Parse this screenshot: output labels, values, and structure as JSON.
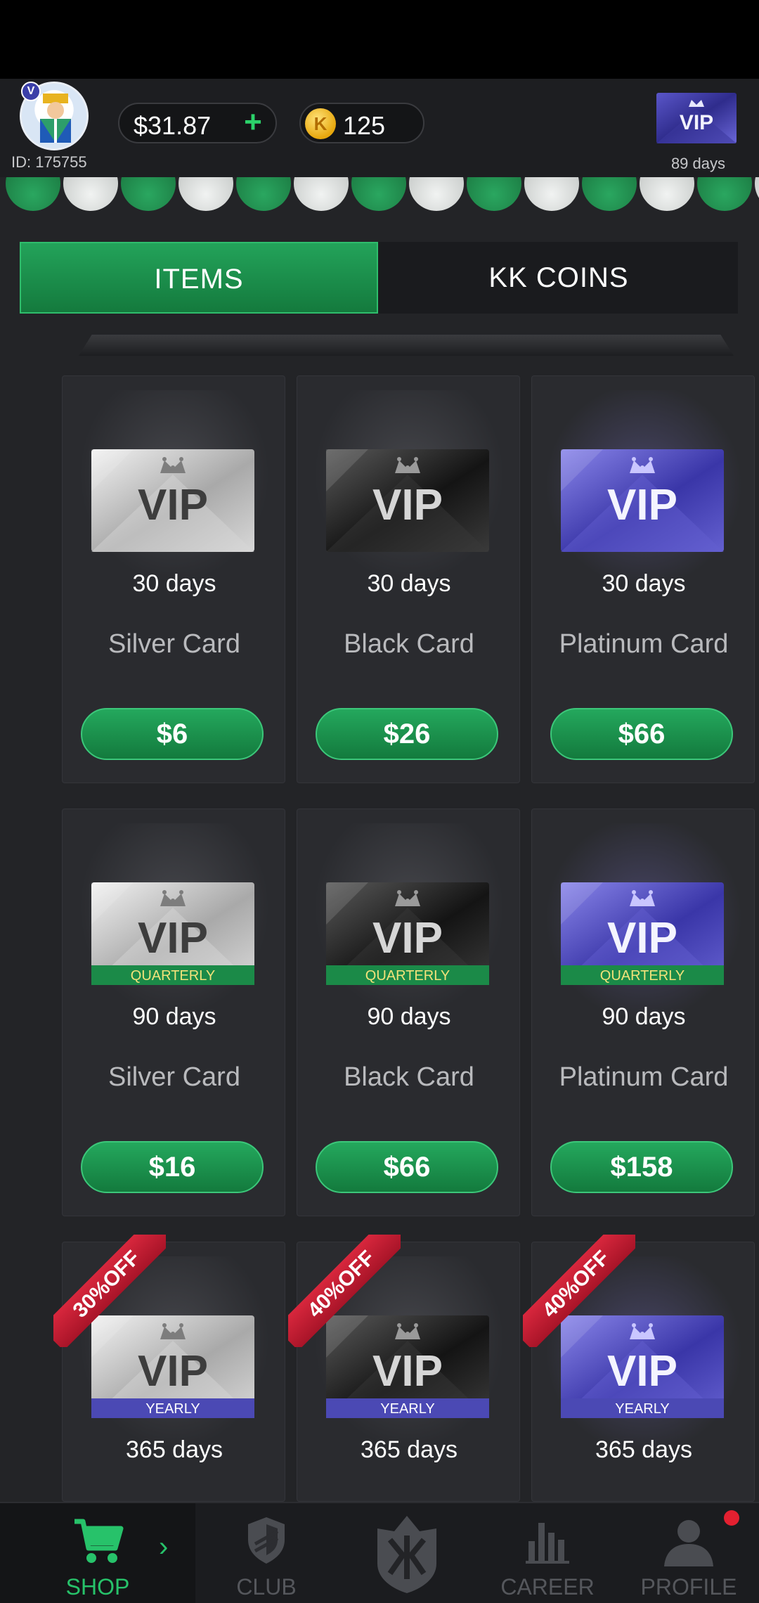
{
  "header": {
    "user_id": "ID: 175755",
    "avatar_badge": "V",
    "cash": "$31.87",
    "coins": "125",
    "coin_symbol": "K",
    "vip_days": "89 days"
  },
  "tabs": [
    {
      "label": "ITEMS",
      "active": true
    },
    {
      "label": "KK COINS",
      "active": false
    }
  ],
  "items": [
    {
      "tier": "silver",
      "days": "30 days",
      "name": "Silver Card",
      "price": "$6",
      "ribbon": "",
      "badge": ""
    },
    {
      "tier": "black",
      "days": "30 days",
      "name": "Black Card",
      "price": "$26",
      "ribbon": "",
      "badge": ""
    },
    {
      "tier": "platinum",
      "days": "30 days",
      "name": "Platinum Card",
      "price": "$66",
      "ribbon": "",
      "badge": ""
    },
    {
      "tier": "silver",
      "days": "90 days",
      "name": "Silver Card",
      "price": "$16",
      "ribbon": "",
      "badge": "QUARTERLY"
    },
    {
      "tier": "black",
      "days": "90 days",
      "name": "Black Card",
      "price": "$66",
      "ribbon": "",
      "badge": "QUARTERLY"
    },
    {
      "tier": "platinum",
      "days": "90 days",
      "name": "Platinum Card",
      "price": "$158",
      "ribbon": "",
      "badge": "QUARTERLY"
    },
    {
      "tier": "silver",
      "days": "365 days",
      "name": "",
      "price": "",
      "ribbon": "30%OFF",
      "badge": "YEARLY"
    },
    {
      "tier": "black",
      "days": "365 days",
      "name": "",
      "price": "",
      "ribbon": "40%OFF",
      "badge": "YEARLY"
    },
    {
      "tier": "platinum",
      "days": "365 days",
      "name": "",
      "price": "",
      "ribbon": "40%OFF",
      "badge": "YEARLY"
    }
  ],
  "vip_text": "VIP",
  "nav": [
    {
      "label": "SHOP",
      "icon": "cart-icon",
      "active": true
    },
    {
      "label": "CLUB",
      "icon": "shield-icon",
      "active": false
    },
    {
      "label": "",
      "icon": "kk-logo-icon",
      "active": false
    },
    {
      "label": "CAREER",
      "icon": "bar-chart-icon",
      "active": false
    },
    {
      "label": "PROFILE",
      "icon": "person-icon",
      "active": false,
      "notification": true
    }
  ],
  "colors": {
    "accent_green": "#1f9a55",
    "background": "#232427",
    "ribbon_red": "#c8192f"
  }
}
